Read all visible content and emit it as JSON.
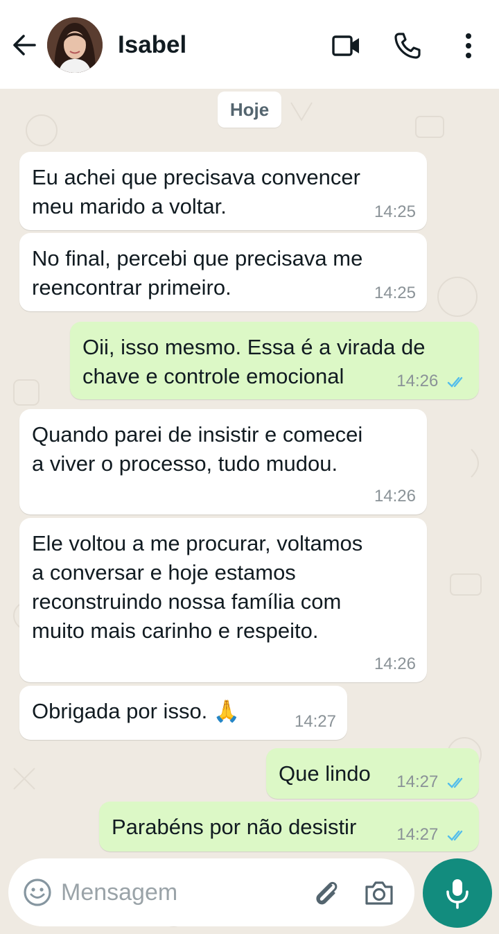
{
  "header": {
    "contact_name": "Isabel",
    "back_icon": "arrow-left-icon",
    "video_icon": "video-camera-icon",
    "call_icon": "phone-icon",
    "menu_icon": "more-vertical-icon"
  },
  "chat": {
    "date_chip": "Hoje",
    "messages": [
      {
        "direction": "in",
        "text": "Eu achei que precisava convencer\nmeu marido a voltar.",
        "time": "14:25"
      },
      {
        "direction": "in",
        "text": "No final, percebi que precisava me\nreencontrar primeiro.",
        "time": "14:25"
      },
      {
        "direction": "out",
        "text": "Oii, isso mesmo. Essa é a virada de\nchave e controle emocional",
        "time": "14:26",
        "status": "read"
      },
      {
        "direction": "in",
        "text": "Quando parei de insistir e comecei\na viver o processo, tudo mudou.",
        "time": "14:26"
      },
      {
        "direction": "in",
        "text": "Ele voltou a me procurar, voltamos\na conversar e hoje estamos\nreconstruindo nossa família com\nmuito mais carinho e respeito.",
        "time": "14:26"
      },
      {
        "direction": "in",
        "text": "Obrigada por isso. 🙏",
        "time": "14:27"
      },
      {
        "direction": "out",
        "text": "Que lindo",
        "time": "14:27",
        "status": "read"
      },
      {
        "direction": "out",
        "text": "Parabéns por não desistir",
        "time": "14:27",
        "status": "read"
      }
    ]
  },
  "input": {
    "placeholder": "Mensagem",
    "emoji_icon": "emoji-icon",
    "attach_icon": "paperclip-icon",
    "camera_icon": "camera-icon",
    "mic_icon": "microphone-icon"
  },
  "colors": {
    "header_bg": "#ffffff",
    "chat_bg": "#efeae2",
    "incoming_bubble": "#ffffff",
    "outgoing_bubble": "#dcf8c6",
    "read_ticks": "#53bdeb",
    "accent": "#128c7e"
  }
}
